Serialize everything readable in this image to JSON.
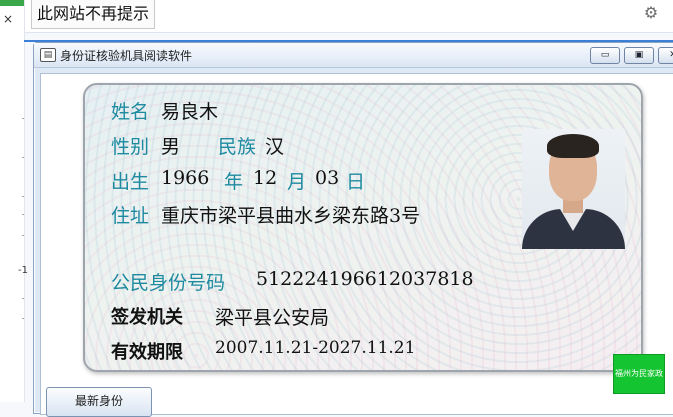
{
  "browser": {
    "no_prompt_label": "此网站不再提示",
    "close_symbol": "×",
    "left_marker": "-1",
    "settings_icon": "gear-icon"
  },
  "window": {
    "title": "身份证核验机具阅读软件",
    "minimize_symbol": "▭",
    "restore_symbol": "▣",
    "close_symbol": "✕"
  },
  "card": {
    "name_label": "姓名",
    "name_value": "易良木",
    "gender_label": "性别",
    "gender_value": "男",
    "ethnicity_label": "民族",
    "ethnicity_value": "汉",
    "birth_label": "出生",
    "birth_year": "1966",
    "year_label": "年",
    "birth_month": "12",
    "month_label": "月",
    "birth_day": "03",
    "day_label": "日",
    "address_label": "住址",
    "address_value": "重庆市梁平县曲水乡梁东路3号",
    "id_label": "公民身份号码",
    "id_value": "512224196612037818",
    "issuer_label": "签发机关",
    "issuer_value": "梁平县公安局",
    "validity_label": "有效期限",
    "validity_value": "2007.11.21-2027.11.21"
  },
  "overlay_button": "福州为民家政",
  "read_button": "最新身份"
}
